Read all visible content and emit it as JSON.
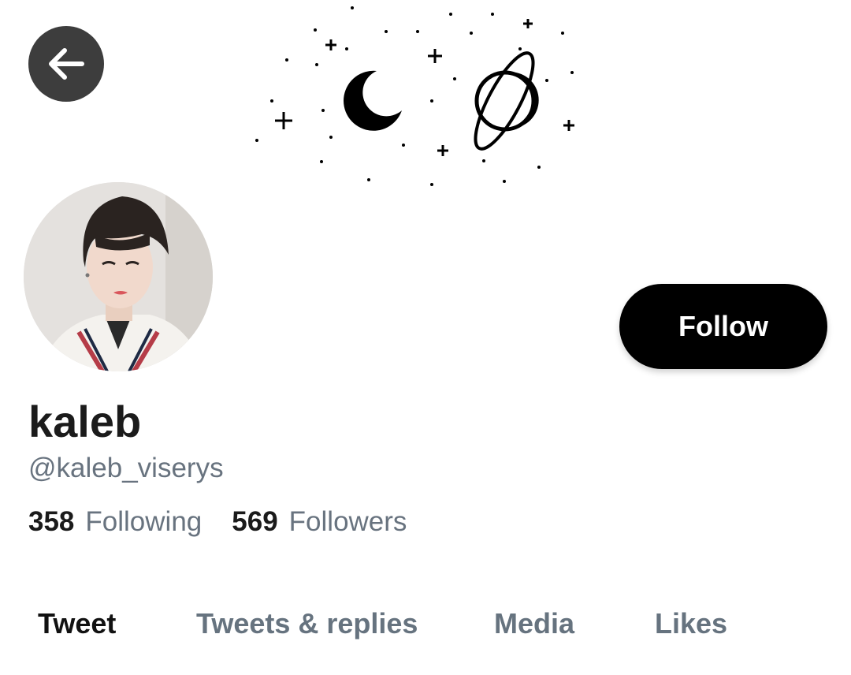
{
  "header": {
    "back_icon": "arrow-left-icon",
    "banner_art": "pixel-moon-planet-stars"
  },
  "profile": {
    "display_name": "kaleb",
    "handle": "@kaleb_viserys",
    "follow_label": "Follow",
    "following_count": "358",
    "following_label": "Following",
    "followers_count": "569",
    "followers_label": "Followers"
  },
  "tabs": [
    {
      "label": "Tweet",
      "active": true
    },
    {
      "label": "Tweets & replies",
      "active": false
    },
    {
      "label": "Media",
      "active": false
    },
    {
      "label": "Likes",
      "active": false
    }
  ],
  "colors": {
    "follow_button_bg": "#000000",
    "secondary_text": "#68737f",
    "back_button_bg": "#3d3d3d"
  }
}
